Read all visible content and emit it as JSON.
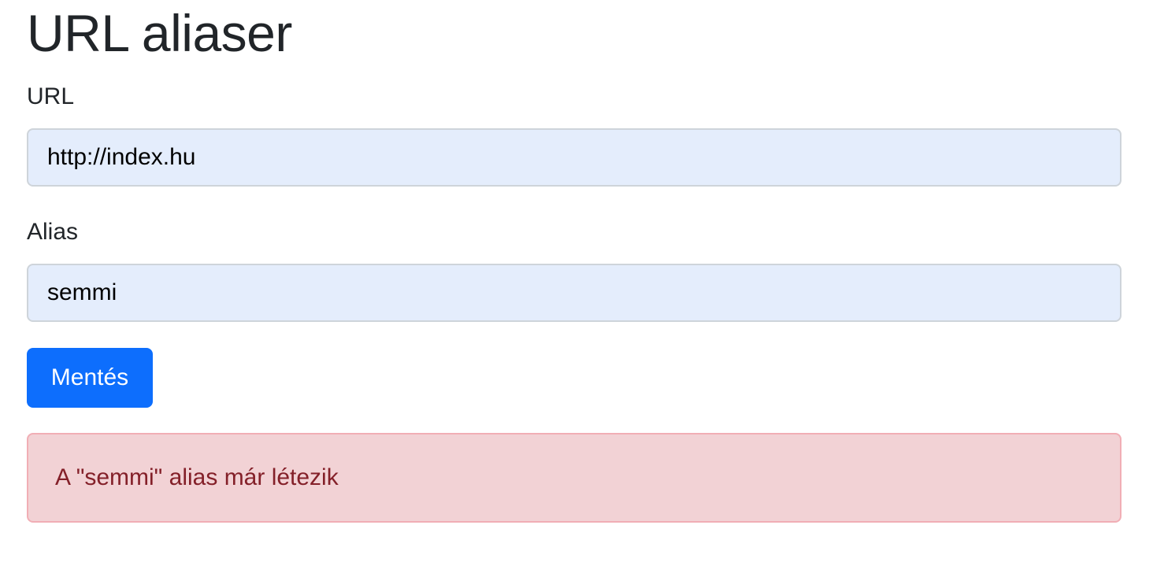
{
  "page": {
    "title": "URL aliaser"
  },
  "form": {
    "url_label": "URL",
    "url_value": "http://index.hu",
    "alias_label": "Alias",
    "alias_value": "semmi",
    "save_label": "Mentés"
  },
  "alert": {
    "message": "A \"semmi\" alias már létezik"
  },
  "colors": {
    "input_background": "#e4edfc",
    "button_primary": "#0d6efd",
    "alert_background": "#f2d2d5",
    "alert_text": "#842029"
  }
}
